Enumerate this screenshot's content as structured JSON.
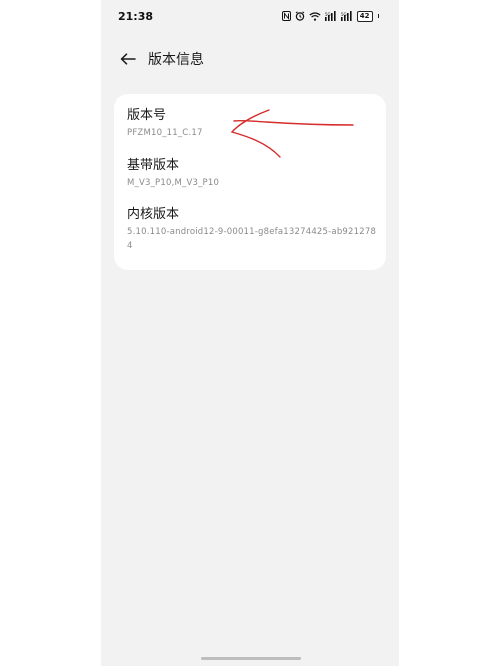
{
  "status_bar": {
    "time": "21:38",
    "battery_level": "42",
    "icons": [
      "nfc-icon",
      "alarm-icon",
      "wifi-icon",
      "signal-icon",
      "signal-icon",
      "battery-icon"
    ]
  },
  "header": {
    "title": "版本信息",
    "back_icon": "back-arrow-icon"
  },
  "items": [
    {
      "label": "版本号",
      "value": "PFZM10_11_C.17"
    },
    {
      "label": "基带版本",
      "value": "M_V3_P10,M_V3_P10"
    },
    {
      "label": "内核版本",
      "value": "5.10.110-android12-9-00011-g8efa13274425-ab921278 4"
    }
  ],
  "colors": {
    "background": "#f2f2f2",
    "card": "#ffffff",
    "annotation": "#d62c2c"
  }
}
